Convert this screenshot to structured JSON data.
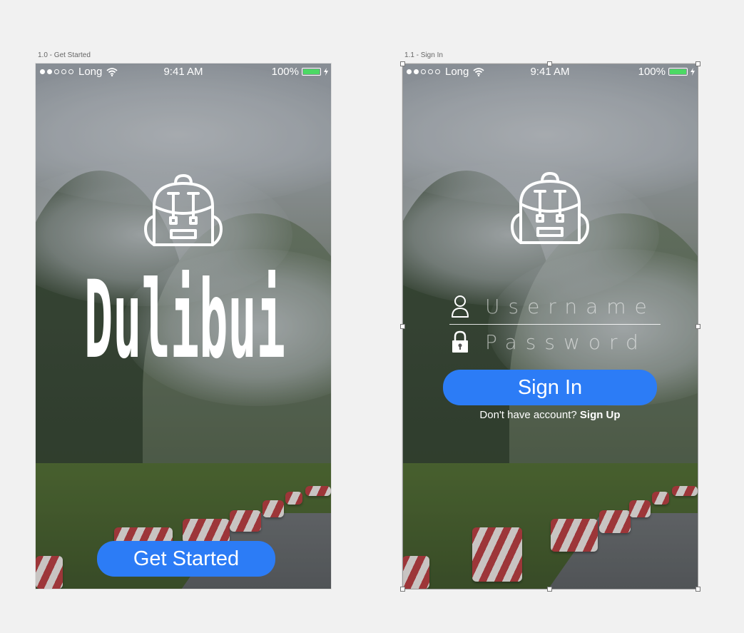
{
  "artboards": [
    {
      "title": "1.0 - Get Started",
      "status": {
        "carrier": "Long",
        "time": "9:41 AM",
        "battery": "100%"
      },
      "brand": "Dulibui",
      "button": "Get Started"
    },
    {
      "title": "1.1 - Sign In",
      "status": {
        "carrier": "Long",
        "time": "9:41 AM",
        "battery": "100%"
      },
      "username_placeholder": "Username",
      "password_placeholder": "Password",
      "button": "Sign In",
      "signup_prompt": "Don't have account?",
      "signup_link": "Sign Up"
    }
  ],
  "colors": {
    "accent": "#2c7cf6",
    "battery": "#4cd964",
    "canvas": "#f1f1f1"
  },
  "icons": [
    "backpack-icon",
    "user-icon",
    "lock-icon",
    "wifi-icon",
    "battery-icon",
    "charging-bolt-icon"
  ]
}
